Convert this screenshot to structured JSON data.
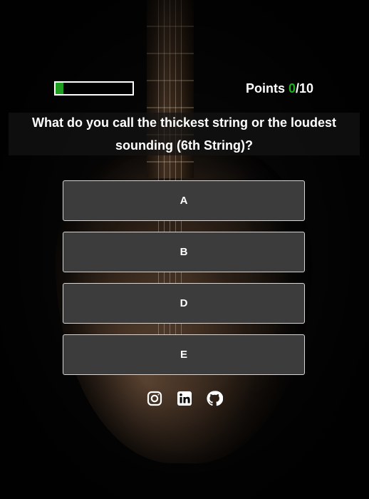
{
  "progress": {
    "fraction": 0.1
  },
  "score": {
    "label": "Points ",
    "current": "0",
    "separator": "/",
    "total": "10"
  },
  "question": {
    "text": "What do you call the thickest string or the loudest sounding (6th String)?"
  },
  "answers": [
    "A",
    "B",
    "D",
    "E"
  ],
  "social": {
    "icons": [
      "instagram-icon",
      "linkedin-icon",
      "github-icon"
    ]
  },
  "colors": {
    "accent": "#1fae1f",
    "button_bg": "#3d3c3d"
  }
}
